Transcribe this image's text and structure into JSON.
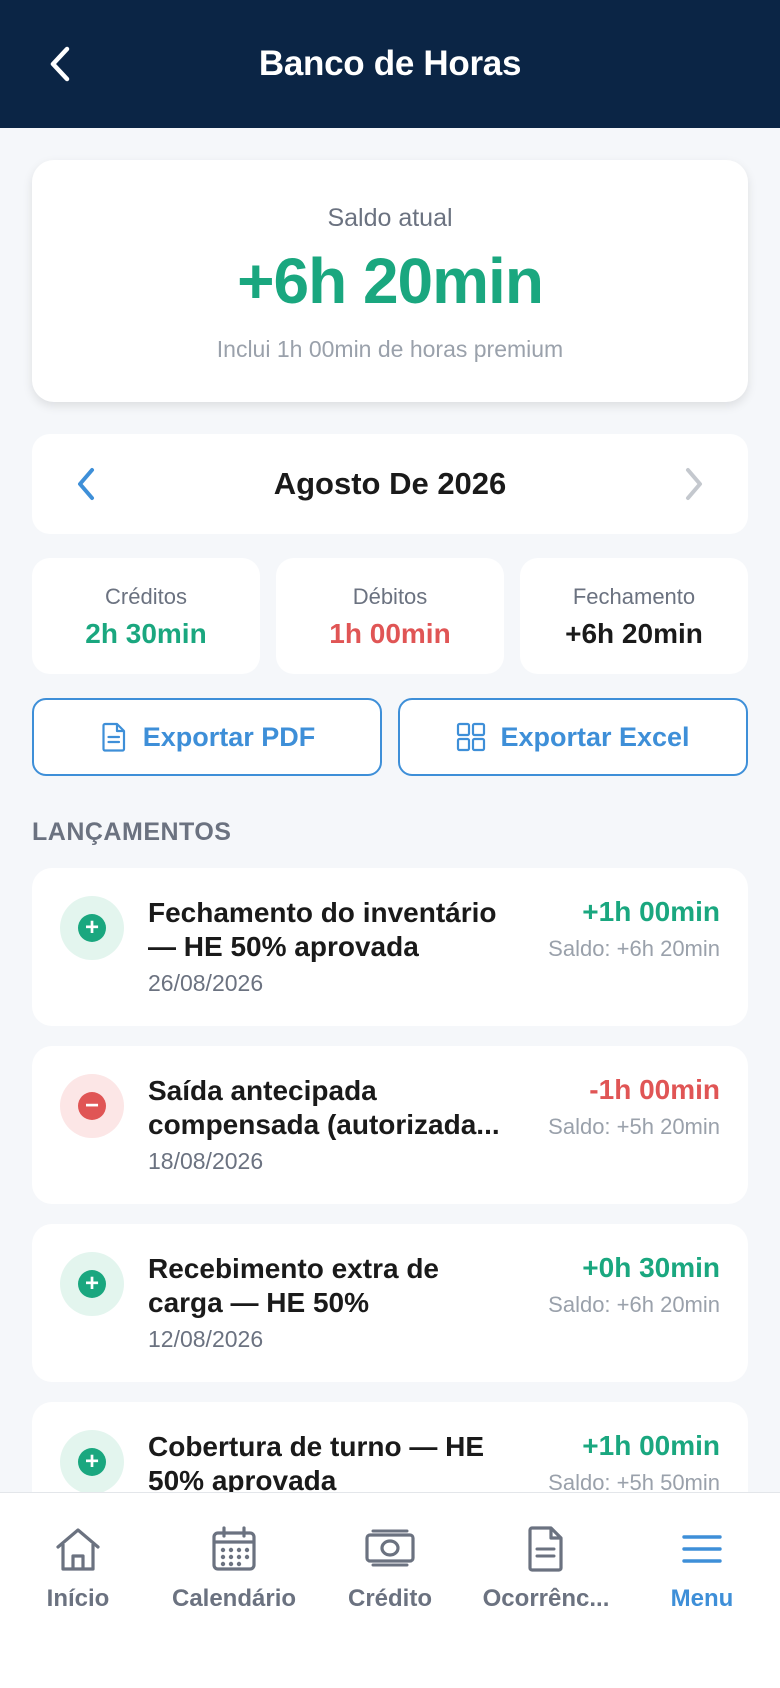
{
  "header": {
    "title": "Banco de Horas"
  },
  "balance": {
    "label": "Saldo atual",
    "value": "+6h 20min",
    "note": "Inclui 1h 00min de horas premium"
  },
  "month": {
    "title": "Agosto De 2026"
  },
  "summary": {
    "credits": {
      "label": "Créditos",
      "value": "2h 30min"
    },
    "debits": {
      "label": "Débitos",
      "value": "1h 00min"
    },
    "closing": {
      "label": "Fechamento",
      "value": "+6h 20min"
    }
  },
  "export": {
    "pdf_label": "Exportar PDF",
    "excel_label": "Exportar Excel"
  },
  "section": {
    "title": "LANÇAMENTOS"
  },
  "entries": [
    {
      "type": "credit",
      "title_line1": "Fechamento do inventário",
      "title_line2": "— HE 50% aprovada",
      "date": "26/08/2026",
      "amount": "+1h 00min",
      "balance": "Saldo: +6h 20min"
    },
    {
      "type": "debit",
      "title_line1": "Saída antecipada",
      "title_line2": "compensada (autorizada...",
      "date": "18/08/2026",
      "amount": "-1h 00min",
      "balance": "Saldo: +5h 20min"
    },
    {
      "type": "credit",
      "title_line1": "Recebimento extra de",
      "title_line2": "carga — HE 50%",
      "date": "12/08/2026",
      "amount": "+0h 30min",
      "balance": "Saldo: +6h 20min"
    },
    {
      "type": "credit",
      "title_line1": "Cobertura de turno — HE",
      "title_line2": "50% aprovada",
      "date": "",
      "amount": "+1h 00min",
      "balance": "Saldo: +5h 50min"
    }
  ],
  "tabs": {
    "home": "Início",
    "calendar": "Calendário",
    "credit": "Crédito",
    "occurrences": "Ocorrênc...",
    "menu": "Menu"
  },
  "colors": {
    "header_bg": "#0B2545",
    "positive": "#1AA77F",
    "negative": "#E05555",
    "accent": "#3E8FD8"
  },
  "icons": {
    "back": "chevron-left-icon",
    "prev_month": "chevron-left-icon",
    "next_month": "chevron-right-icon",
    "pdf": "document-icon",
    "excel": "grid-icon",
    "credit_entry": "plus-icon",
    "debit_entry": "minus-icon",
    "tab_home": "home-icon",
    "tab_calendar": "calendar-icon",
    "tab_credit": "banknote-icon",
    "tab_occurrences": "document-icon",
    "tab_menu": "hamburger-icon"
  }
}
